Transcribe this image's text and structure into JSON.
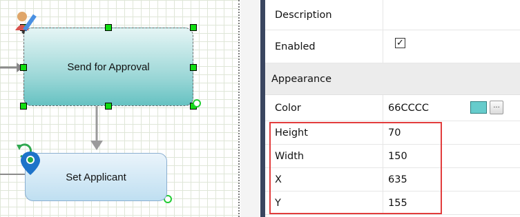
{
  "canvas": {
    "shapes": [
      {
        "label": "Send for Approval",
        "color": "#66CCCC",
        "selected": true
      },
      {
        "label": "Set Applicant",
        "color": "#BFDFF1",
        "selected": false
      }
    ]
  },
  "properties": {
    "rows": [
      {
        "name": "Description",
        "value": ""
      },
      {
        "name": "Enabled",
        "checked": true,
        "check_glyph": "✓"
      }
    ],
    "appearance": {
      "category_label": "Appearance",
      "color": {
        "name": "Color",
        "value": "66CCCC",
        "swatch": "#66CCCC",
        "button_label": "..."
      },
      "height": {
        "name": "Height",
        "value": "70"
      },
      "width": {
        "name": "Width",
        "value": "150"
      },
      "x": {
        "name": "X",
        "value": "635"
      },
      "y": {
        "name": "Y",
        "value": "155"
      }
    }
  },
  "icons": [
    "user-edit-icon",
    "location-pin-icon",
    "refresh-icon"
  ],
  "highlight_color": "#E23C3C"
}
